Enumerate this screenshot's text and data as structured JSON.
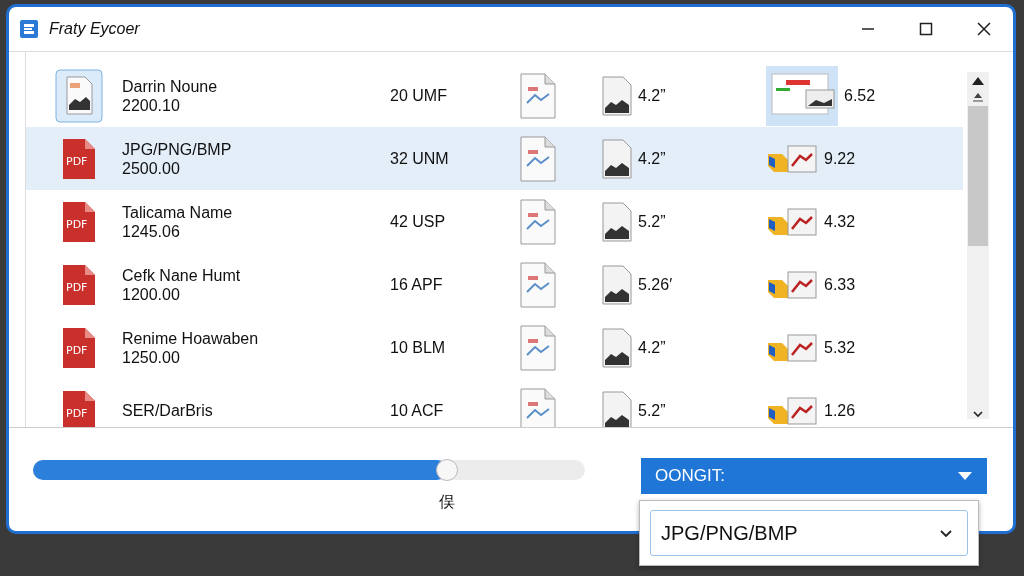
{
  "window": {
    "title": "Fraty Eycoer"
  },
  "rows": [
    {
      "kind": "image",
      "name": "Darrin Noune",
      "value": "2200.10",
      "unit": "20 UMF",
      "size": "4.2”",
      "score": "6.52",
      "selected": false
    },
    {
      "kind": "pdf",
      "badge": "PDF",
      "name": "JPG/PNG/BMP",
      "value": "2500.00",
      "unit": "32 UNM",
      "size": "4.2”",
      "score": "9.22",
      "selected": true
    },
    {
      "kind": "pdf",
      "badge": "PDF",
      "name": "Talicama Name",
      "value": "1245.06",
      "unit": "42 USP",
      "size": "5.2”",
      "score": "4.32",
      "selected": false
    },
    {
      "kind": "pdf",
      "badge": "PDF",
      "name": "Cefk Nane Humt",
      "value": "1200.00",
      "unit": "16 APF",
      "size": "5.26′",
      "score": "6.33",
      "selected": false
    },
    {
      "kind": "pdf",
      "badge": "PDF",
      "name": "Renime Hoawaben",
      "value": "1250.00",
      "unit": "10 BLM",
      "size": "4.2”",
      "score": "5.32",
      "selected": false
    },
    {
      "kind": "pdf",
      "badge": "PDF",
      "name": "SER/DarBris",
      "unit": "10 ACF",
      "size": "5.2”",
      "score": "1.26",
      "selected": false
    }
  ],
  "slider": {
    "level": 0.75,
    "label": "俣"
  },
  "dropdown": {
    "label": "OONGIT:"
  },
  "format_select": {
    "value": "JPG/PNG/BMP"
  }
}
